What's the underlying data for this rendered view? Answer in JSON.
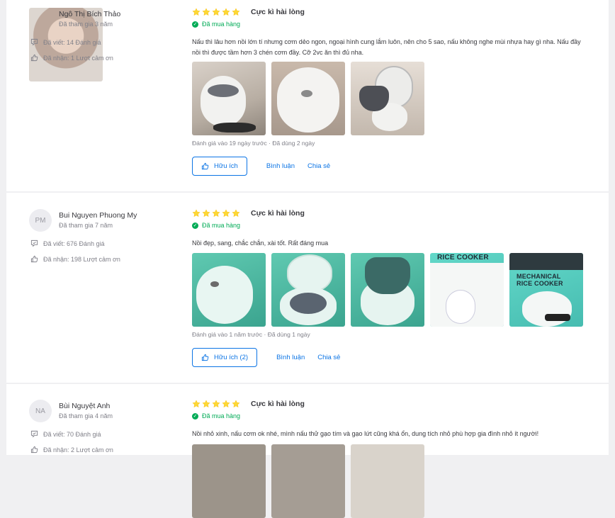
{
  "reviews": [
    {
      "user": {
        "name": "Ngô Thị Bích Thảo",
        "joined": "Đã tham gia 3 năm",
        "written": "Đã viết: 14 Đánh giá",
        "thanks": "Đã nhận: 1 Lượt cảm ơn",
        "initials": ""
      },
      "rating": 5,
      "title": "Cực kì hài lòng",
      "bought": "Đã mua hàng",
      "content": "Nấu thì lâu hơn nồi lớn tí nhưng cơm dẻo ngon, ngoại hình cung lắm luôn, nên cho 5 sao, nấu không nghe mùi nhựa hay gì nha. Nấu đầy nồi thì được tầm hơn 3 chén cơm đầy. Cỡ 2vc ăn thì đủ nha.",
      "photo_count": 3,
      "meta": "Đánh giá vào 19 ngày trước · Đã dùng 2 ngày",
      "helpful": "Hữu ích",
      "reply": "Bình luận",
      "share": "Chia sẻ"
    },
    {
      "user": {
        "name": "Bui Nguyen Phuong My",
        "joined": "Đã tham gia 7 năm",
        "written": "Đã viết: 676 Đánh giá",
        "thanks": "Đã nhận: 198 Lượt cảm ơn",
        "initials": "PM"
      },
      "rating": 5,
      "title": "Cực kì hài lòng",
      "bought": "Đã mua hàng",
      "content": "Nồi đẹp, sang, chắc chắn, xài tốt. Rất đáng mua",
      "photo_count": 5,
      "photo_texts": [
        "RICE COOKER",
        "MECHANICAL RICE COOKER"
      ],
      "meta": "Đánh giá vào 1 năm trước · Đã dùng 1 ngày",
      "helpful": "Hữu ích (2)",
      "reply": "Bình luận",
      "share": "Chia sẻ"
    },
    {
      "user": {
        "name": "Bùi Nguyệt Anh",
        "joined": "Đã tham gia 4 năm",
        "written": "Đã viết: 70 Đánh giá",
        "thanks": "Đã nhận: 2 Lượt cảm ơn",
        "initials": "NA"
      },
      "rating": 5,
      "title": "Cực kì hài lòng",
      "bought": "Đã mua hàng",
      "content": "Nồi nhỏ xinh, nấu cơm ok nhé, mình nấu thử gạo tím và gạo lứt cũng khá ổn, dung tích nhỏ phù hợp gia đình nhỏ ít người!"
    }
  ],
  "colors": {
    "star": "#fdd836",
    "verified": "#00ab56",
    "link": "#0b74e5",
    "muted": "#808089"
  },
  "icons": {
    "written": "chat-review-icon",
    "thanks": "thumb-up-icon",
    "verified": "check-circle-icon",
    "star": "star-icon"
  }
}
